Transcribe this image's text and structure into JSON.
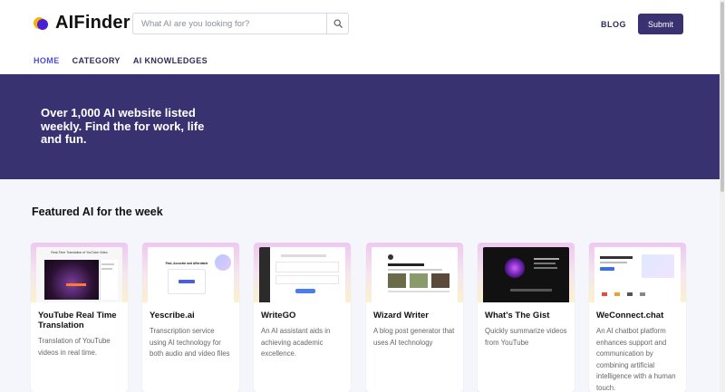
{
  "header": {
    "logo_text": "AIFinder",
    "search_placeholder": "What AI are you looking for?",
    "blog_label": "BLOG",
    "submit_label": "Submit"
  },
  "nav": {
    "items": [
      {
        "label": "HOME",
        "active": true
      },
      {
        "label": "CATEGORY",
        "active": false
      },
      {
        "label": "AI KNOWLEDGES",
        "active": false
      }
    ]
  },
  "hero": {
    "headline": "Over 1,000 AI website listed weekly. Find the for work, life and fun."
  },
  "featured": {
    "title": "Featured AI for the week",
    "cards": [
      {
        "title": "YouTube Real Time Translation",
        "description": "Translation of YouTube videos in real time.",
        "thumb_caption": "Real-Time Translation of YouTube Video"
      },
      {
        "title": "Yescribe.ai",
        "description": "Transcription service using AI technology for both audio and video files",
        "thumb_caption": "Fast, Accurate and Affordable Transcription"
      },
      {
        "title": "WriteGO",
        "description": "An AI assistant aids in achieving academic excellence.",
        "thumb_caption": ""
      },
      {
        "title": "Wizard Writer",
        "description": "A blog post generator that uses AI technology",
        "thumb_caption": ""
      },
      {
        "title": "What's The Gist",
        "description": "Quickly summarize videos from YouTube",
        "thumb_caption": ""
      },
      {
        "title": "WeConnect.chat",
        "description": "An AI chatbot platform enhances support and communication by combining artificial intelligence with a human touch.",
        "thumb_caption": ""
      }
    ]
  },
  "colors": {
    "brand": "#393271",
    "accent": "#4a4fd6",
    "logo_dot_back": "#f5b400",
    "logo_dot_front": "#4a1fd6"
  }
}
